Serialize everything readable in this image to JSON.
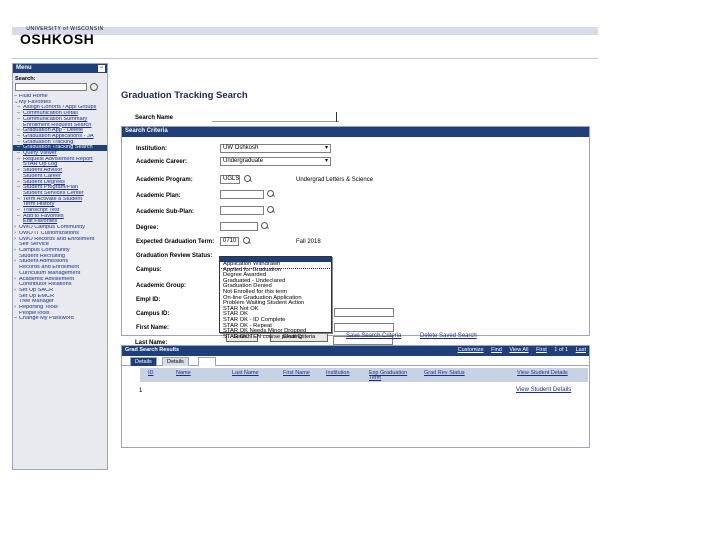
{
  "header": {
    "logo_top": "UNIVERSITY of WISCONSIN",
    "logo_main": "OSHKOSH"
  },
  "sidebar": {
    "title": "Menu",
    "collapse_glyph": "−",
    "search_label": "Search:",
    "items": [
      {
        "mark": "–",
        "label": "Fluid Home",
        "level": "top"
      },
      {
        "mark": "⌄",
        "label": "My Favorites",
        "level": "top"
      },
      {
        "mark": "–",
        "label": "Assign Cohorts / Appl Groups",
        "level": "sub"
      },
      {
        "mark": "–",
        "label": "Communication Detail",
        "level": "sub"
      },
      {
        "mark": "–",
        "label": "Communication Summary",
        "level": "sub"
      },
      {
        "mark": "",
        "label": "Enrollment Request Search",
        "level": "cont"
      },
      {
        "mark": "–",
        "label": "Graduation App - Delete",
        "level": "sub"
      },
      {
        "mark": "–",
        "label": "Graduation Applications - JA",
        "level": "sub"
      },
      {
        "mark": "–",
        "label": "Graduation Tracking",
        "level": "sub"
      },
      {
        "mark": "–",
        "label": "Graduation Tracking Search",
        "level": "active"
      },
      {
        "mark": "–",
        "label": "Query Viewer",
        "level": "sub"
      },
      {
        "mark": "–",
        "label": "Request Advisement Report",
        "level": "sub"
      },
      {
        "mark": "",
        "label": "STAR Op Log",
        "level": "cont"
      },
      {
        "mark": "–",
        "label": "Student Advisor",
        "level": "sub"
      },
      {
        "mark": "",
        "label": "Student Career",
        "level": "cont"
      },
      {
        "mark": "–",
        "label": "Student Degrees",
        "level": "sub"
      },
      {
        "mark": "–",
        "label": "Student Program/Plan",
        "level": "sub"
      },
      {
        "mark": "",
        "label": "Student Services Center",
        "level": "cont"
      },
      {
        "mark": "–",
        "label": "Term Activate a Student",
        "level": "sub"
      },
      {
        "mark": "",
        "label": "Term History",
        "level": "cont"
      },
      {
        "mark": "–",
        "label": "Transcript Test",
        "level": "sub"
      },
      {
        "mark": "–",
        "label": "Add to Favorites",
        "level": "sub"
      },
      {
        "mark": "",
        "label": "Edit Favorites",
        "level": "cont"
      },
      {
        "mark": "›",
        "label": "UWO Campus Community",
        "level": "top"
      },
      {
        "mark": "›",
        "label": "UWO IT Customizations",
        "level": "top"
      },
      {
        "mark": "›",
        "label": "UWO Records and Enrollment",
        "level": "top"
      },
      {
        "mark": "",
        "label": "Self Service",
        "level": "top"
      },
      {
        "mark": "›",
        "label": "Campus Community",
        "level": "top"
      },
      {
        "mark": "",
        "label": "Student Recruiting",
        "level": "top"
      },
      {
        "mark": "›",
        "label": "Student Admissions",
        "level": "top"
      },
      {
        "mark": "",
        "label": "Records and Enrollment",
        "level": "top"
      },
      {
        "mark": "",
        "label": "Curriculum Management",
        "level": "top"
      },
      {
        "mark": "›",
        "label": "Academic Advisement",
        "level": "top"
      },
      {
        "mark": "",
        "label": "Contributor Relations",
        "level": "top"
      },
      {
        "mark": "›",
        "label": "Set Up SACR",
        "level": "top"
      },
      {
        "mark": "",
        "label": "Set Up EMCR",
        "level": "top"
      },
      {
        "mark": "",
        "label": "Tree Manager",
        "level": "top"
      },
      {
        "mark": "›",
        "label": "Reporting Tools",
        "level": "top"
      },
      {
        "mark": "",
        "label": "PeopleTools",
        "level": "top"
      },
      {
        "mark": "–",
        "label": "Change My Password",
        "level": "top"
      }
    ]
  },
  "main": {
    "title": "Graduation Tracking Search",
    "search_name_label": "Search Name",
    "criteria_title": "Search Criteria",
    "fields": {
      "institution_label": "Institution:",
      "institution_value": "UW Oshkosh",
      "career_label": "Academic Career:",
      "career_value": "Undergraduate",
      "program_label": "Academic Program:",
      "program_value": "UGLS",
      "program_desc": "Undergrad Letters & Science",
      "plan_label": "Academic Plan:",
      "subplan_label": "Academic Sub-Plan:",
      "degree_label": "Degree:",
      "exp_grad_label": "Expected Graduation Term:",
      "exp_grad_value": "0710",
      "exp_grad_desc": "Fall 2018",
      "review_status_label": "Graduation Review Status:",
      "campus_label": "Campus:",
      "academic_group_label": "Academic Group:",
      "emplid_label": "Empl ID:",
      "campus_id_label": "Campus ID:",
      "first_name_label": "First Name:",
      "last_name_label": "Last Name:"
    },
    "review_status_options": [
      "Application Withdrawn",
      "Applied for Graduation",
      "Degree Awarded",
      "Graduated - Undeclared",
      "Graduation Denied",
      "Not Enrolled for this term",
      "On-line Graduation Application",
      "Problem Waiting Student Action",
      "STAR Not OK",
      "STAR OK",
      "STAR OK - ID Complete",
      "STAR OK - Repeat",
      "STAR OK Needs Minor Dropped",
      "STAR OK TEN course pending"
    ],
    "buttons": {
      "search": "Search",
      "clear": "Clear Criteria"
    },
    "links": {
      "save_search": "Save Search Criteria",
      "delete_search": "Delete Saved Search"
    }
  },
  "grid": {
    "title": "Grad Search Results",
    "nav": {
      "customize": "Customize",
      "find": "Find",
      "view_all": "View All",
      "first": "First",
      "range": "1 of 1",
      "last": "Last"
    },
    "tabs": [
      "Details",
      "Details"
    ],
    "columns": [
      "ID",
      "Name",
      "Last Name",
      "First Name",
      "Institution",
      "Exp Graduation Term",
      "Grad Rev Status",
      "View Student Details"
    ],
    "rows": [
      {
        "num": "1",
        "link": "View Student Details"
      }
    ]
  }
}
